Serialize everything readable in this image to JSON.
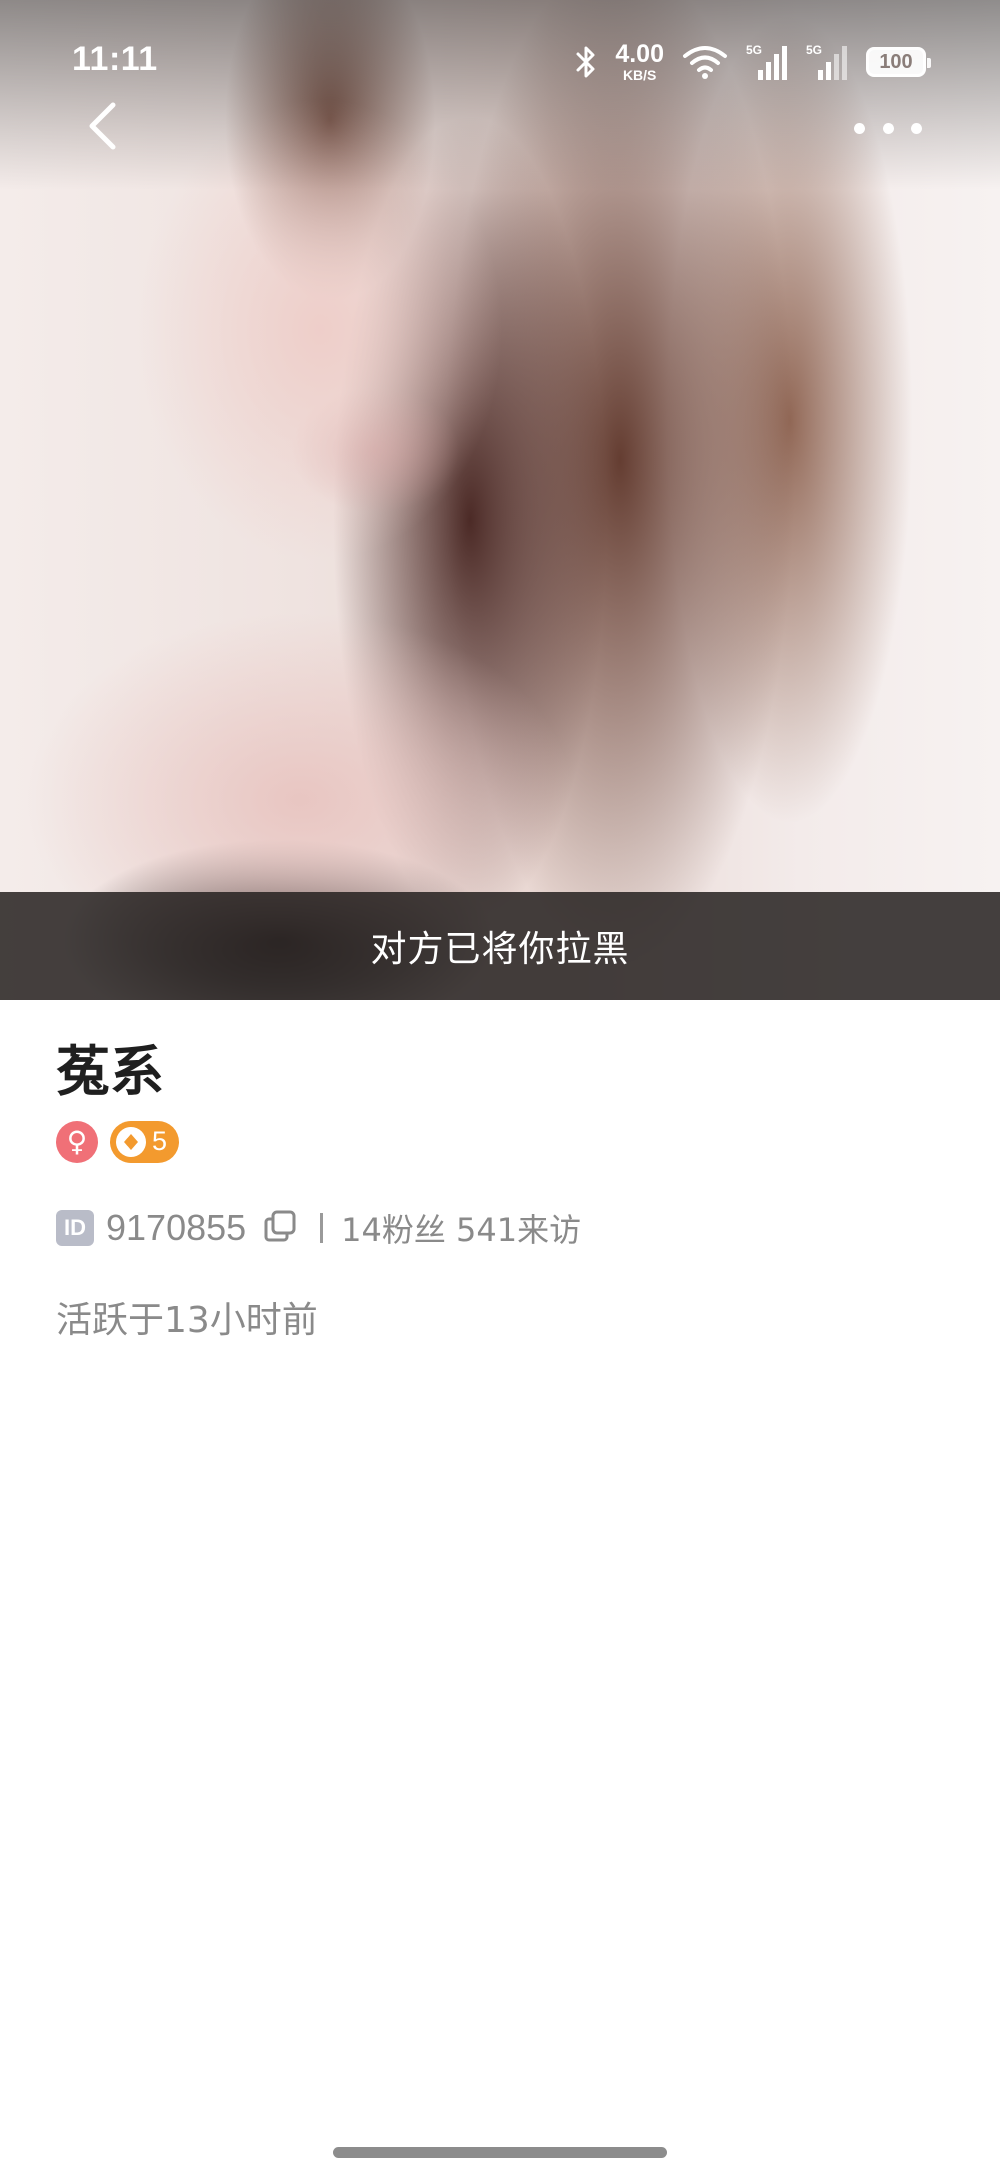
{
  "status_bar": {
    "time": "11:11",
    "net_speed_value": "4.00",
    "net_speed_unit": "KB/S",
    "signal_1_label": "5G",
    "signal_2_label": "5G",
    "battery_level": "100",
    "icons": [
      "bluetooth-icon",
      "wifi-icon",
      "signal-5g-icon",
      "signal-5g-icon",
      "battery-icon"
    ]
  },
  "nav": {
    "back_icon": "chevron-left-icon",
    "more_icon": "more-horizontal-icon"
  },
  "hero": {
    "blocked_notice": "对方已将你拉黑"
  },
  "profile": {
    "name": "菟系",
    "gender_symbol": "♀",
    "level": "5",
    "id_tag": "ID",
    "id_number": "9170855",
    "stats": "14粉丝 541来访",
    "active_text": "活跃于13小时前"
  },
  "colors": {
    "gender_badge": "#f07077",
    "level_badge": "#f39a2e",
    "id_tag": "#b9bcc8",
    "secondary_text": "#8a8a8a",
    "banner": "#262221"
  }
}
